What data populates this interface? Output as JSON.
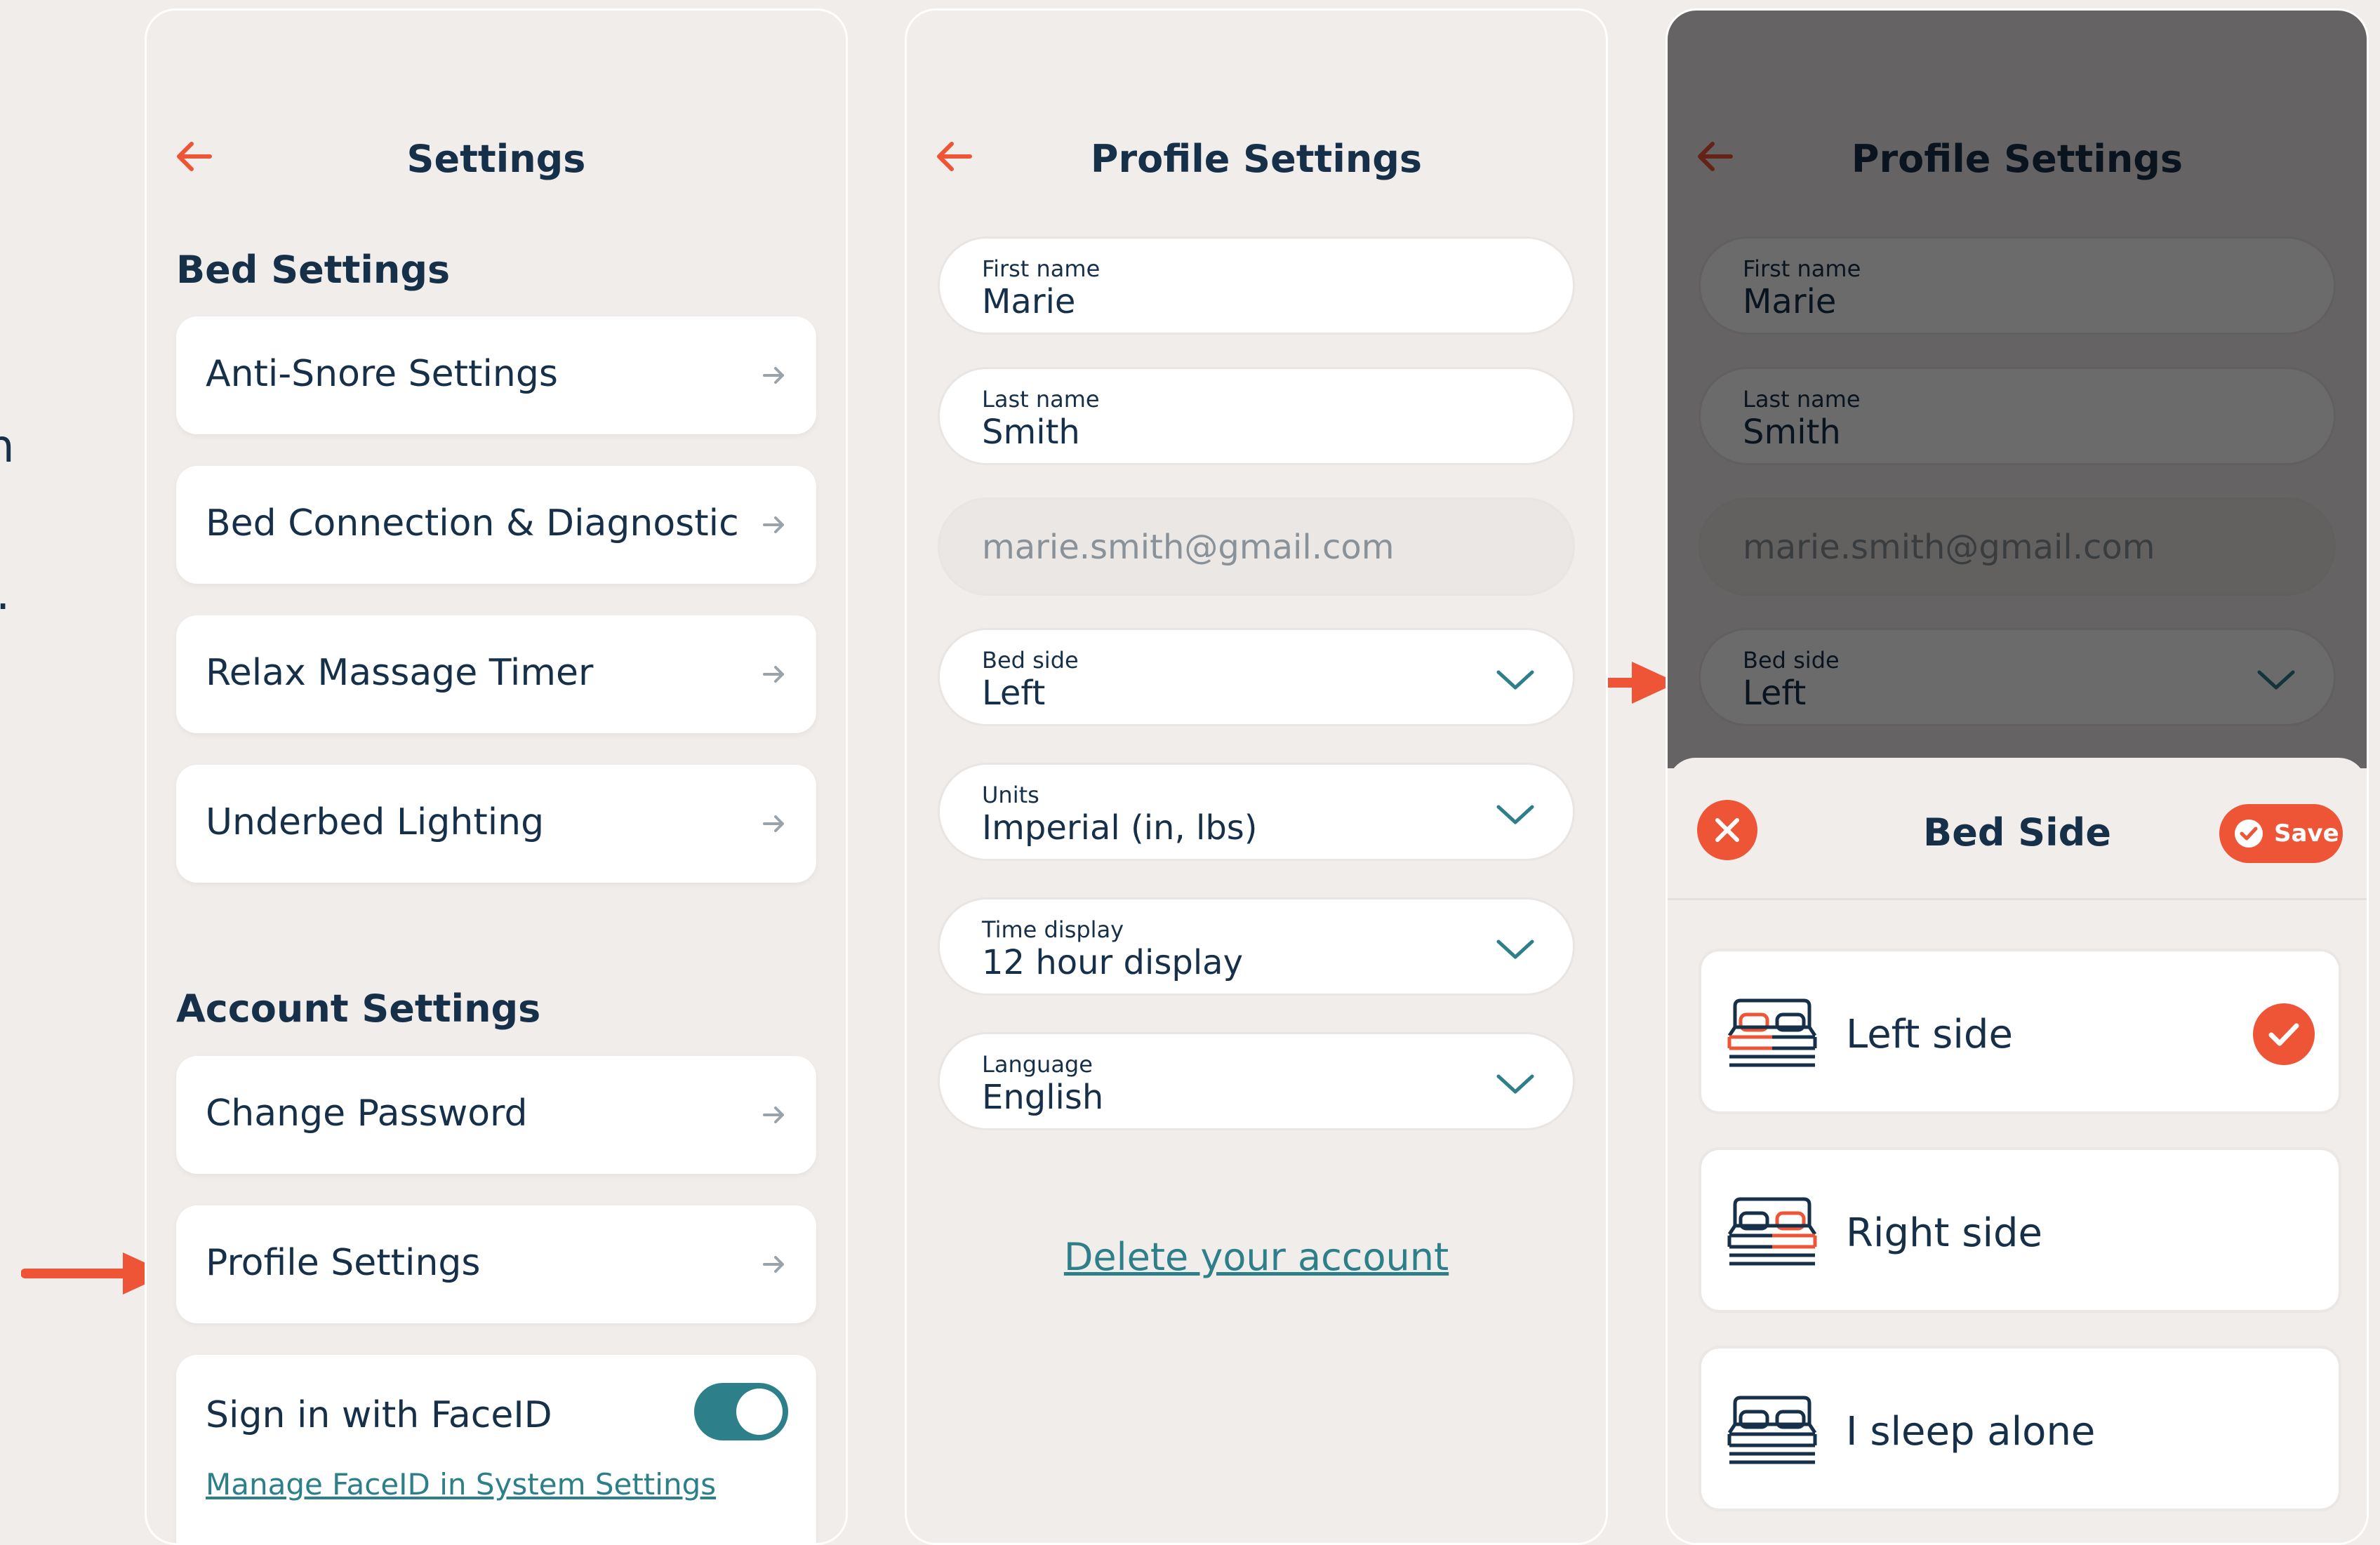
{
  "colors": {
    "background": "#f1edeb",
    "card": "#ffffff",
    "text": "#173049",
    "accent": "#ee5436",
    "teal": "#2d7f89",
    "overlay": "rgba(0,0,0,0.58)"
  },
  "edge_text": [
    "n",
    "."
  ],
  "settings_screen": {
    "title": "Settings",
    "back_icon": "left-arrow-icon",
    "bed_settings": {
      "heading": "Bed Settings",
      "items": [
        {
          "label": "Anti-Snore Settings"
        },
        {
          "label": "Bed Connection & Diagnostic"
        },
        {
          "label": "Relax Massage Timer"
        },
        {
          "label": "Underbed Lighting"
        }
      ]
    },
    "account_settings": {
      "heading": "Account Settings",
      "items": [
        {
          "label": "Change Password"
        },
        {
          "label": "Profile Settings"
        }
      ],
      "faceid": {
        "label": "Sign in with FaceID",
        "enabled": true,
        "link": "Manage FaceID in System Settings"
      }
    }
  },
  "profile_screen": {
    "title": "Profile Settings",
    "fields": {
      "first_name": {
        "label": "First name",
        "value": "Marie"
      },
      "last_name": {
        "label": "Last name",
        "value": "Smith"
      },
      "email": {
        "placeholder": "marie.smith@gmail.com"
      },
      "bed_side": {
        "label": "Bed side",
        "value": "Left"
      },
      "units": {
        "label": "Units",
        "value": "Imperial (in, lbs)"
      },
      "time_display": {
        "label": "Time display",
        "value": "12 hour display"
      },
      "language": {
        "label": "Language",
        "value": "English"
      }
    },
    "delete_link": "Delete your account"
  },
  "bed_side_sheet": {
    "title": "Bed Side",
    "save_label": "Save",
    "options": [
      {
        "label": "Left side",
        "selected": true
      },
      {
        "label": "Right side",
        "selected": false
      },
      {
        "label": "I sleep alone",
        "selected": false
      }
    ]
  }
}
